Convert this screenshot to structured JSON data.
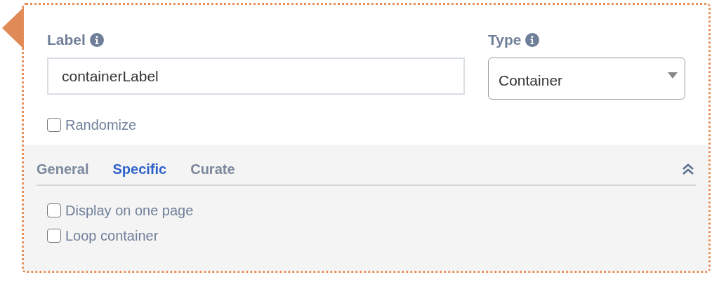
{
  "label_field": {
    "label": "Label",
    "value": "containerLabel"
  },
  "type_field": {
    "label": "Type",
    "value": "Container"
  },
  "randomize": {
    "label": "Randomize",
    "checked": false
  },
  "tabs": [
    {
      "label": "General",
      "selected": false
    },
    {
      "label": "Specific",
      "selected": true
    },
    {
      "label": "Curate",
      "selected": false
    }
  ],
  "options": [
    {
      "label": "Display on one page",
      "checked": false
    },
    {
      "label": "Loop container",
      "checked": false
    }
  ]
}
